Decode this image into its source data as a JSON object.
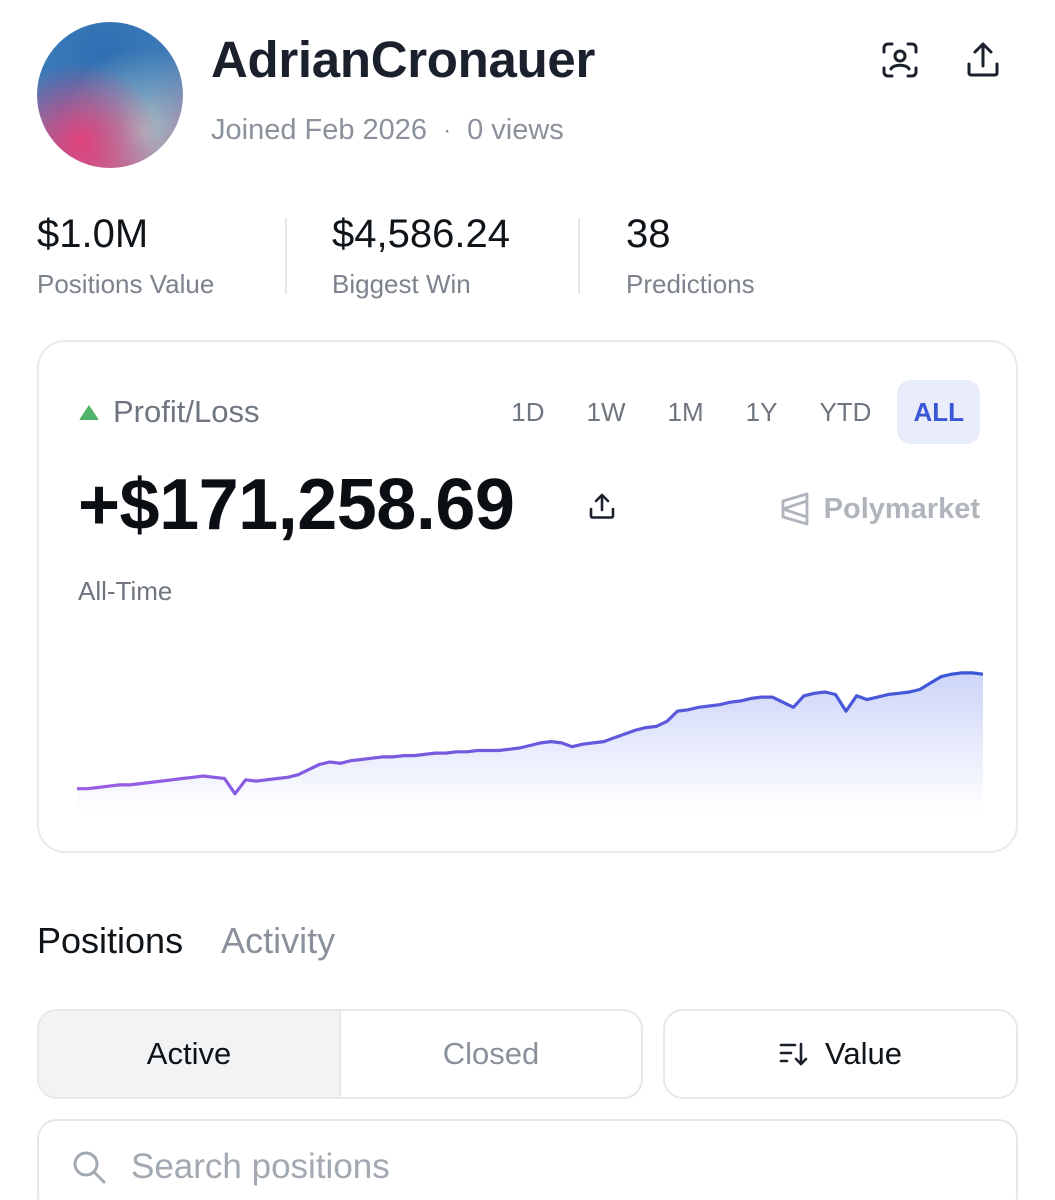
{
  "profile": {
    "username": "AdrianCronauer",
    "joined": "Joined Feb 2026",
    "separator": "·",
    "views": "0 views"
  },
  "header_icons": [
    "scan-profile-icon",
    "share-icon"
  ],
  "stats": {
    "positions_value": "$1.0M",
    "positions_value_label": "Positions Value",
    "biggest_win": "$4,586.24",
    "biggest_win_label": "Biggest Win",
    "predictions": "38",
    "predictions_label": "Predictions"
  },
  "pnl": {
    "label": "Profit/Loss",
    "value": "+$171,258.69",
    "period": "All-Time",
    "brand": "Polymarket",
    "ranges": [
      "1D",
      "1W",
      "1M",
      "1Y",
      "YTD",
      "ALL"
    ],
    "active_range": "ALL",
    "indicator_color": "#4fb36a",
    "accent_color": "#3a57d6"
  },
  "chart_data": {
    "type": "area",
    "title": "",
    "xlabel": "",
    "ylabel": "",
    "grid": false,
    "line_color_start": "#9b5de5",
    "line_color_end": "#3a57d6",
    "series": [
      {
        "values": [
          2,
          2,
          3,
          4,
          5,
          5,
          6,
          7,
          8,
          9,
          10,
          11,
          12,
          11,
          10,
          -2,
          9,
          8,
          9,
          10,
          11,
          13,
          17,
          21,
          23,
          22,
          24,
          25,
          26,
          27,
          27,
          28,
          28,
          29,
          30,
          30,
          31,
          31,
          32,
          32,
          32,
          33,
          34,
          36,
          38,
          39,
          38,
          35,
          37,
          38,
          39,
          42,
          45,
          48,
          50,
          51,
          55,
          63,
          64,
          66,
          67,
          68,
          70,
          71,
          73,
          74,
          74,
          70,
          66,
          75,
          77,
          78,
          76,
          63,
          75,
          72,
          74,
          76,
          77,
          78,
          80,
          85,
          90,
          92,
          93,
          93,
          92
        ]
      }
    ],
    "ylim": [
      -10,
      100
    ]
  },
  "tabs": [
    "Positions",
    "Activity"
  ],
  "active_tab": "Positions",
  "filters": {
    "active_label": "Active",
    "closed_label": "Closed",
    "sort_label": "Value"
  },
  "search": {
    "placeholder": "Search positions"
  }
}
